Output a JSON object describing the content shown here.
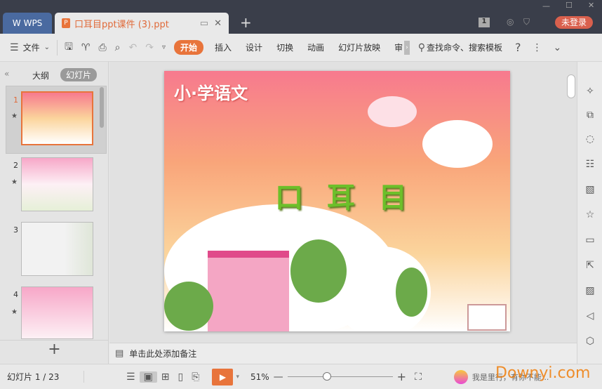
{
  "titlebar": {
    "app": "WPS",
    "doc_tab": "口耳目ppt课件 (3).ppt",
    "badge": "1",
    "login": "未登录"
  },
  "toolbar": {
    "file": "文件",
    "tabs": [
      "开始",
      "插入",
      "设计",
      "切换",
      "动画",
      "幻灯片放映",
      "审"
    ],
    "search": "查找命令、搜索模板",
    "help": "?"
  },
  "leftpanel": {
    "tabs": [
      "大纲",
      "幻灯片"
    ],
    "slides": [
      "1",
      "2",
      "3",
      "4"
    ]
  },
  "slide": {
    "heading": "小·学语文",
    "title": "口 耳 目"
  },
  "notes": {
    "placeholder": "单击此处添加备注"
  },
  "status": {
    "slide_counter": "幻灯片 1 / 23",
    "zoom": "51%",
    "watermark": "Downyi.com",
    "hint": "我是里行，有你不能..."
  },
  "colors": {
    "accent": "#e8743b",
    "titlebar": "#3a3e4a"
  }
}
